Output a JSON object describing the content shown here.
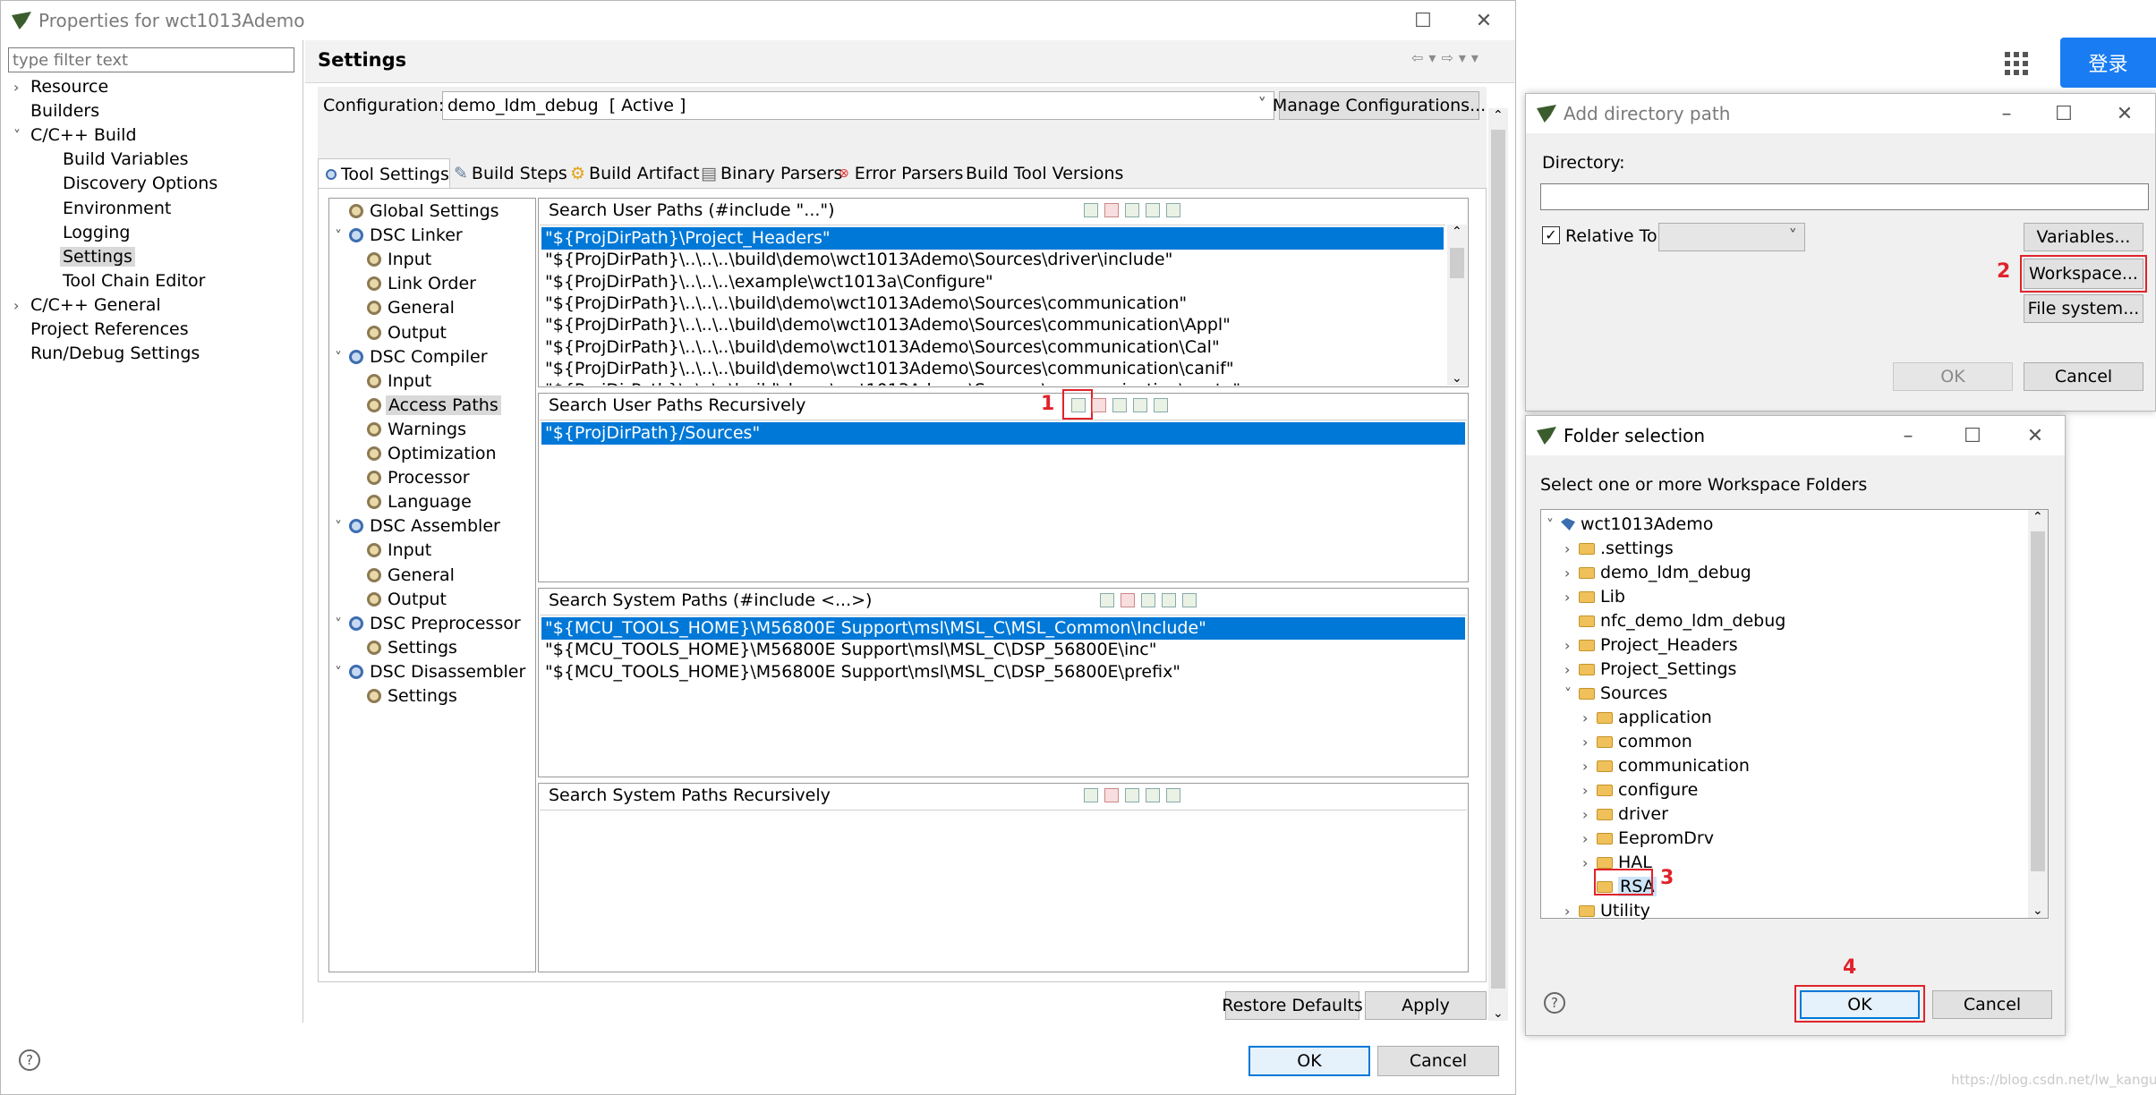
{
  "main_window": {
    "title": "Properties for wct1013Ademo",
    "filter_placeholder": "type filter text",
    "nav": [
      {
        "label": "Resource",
        "indent": 0,
        "twisty": "›"
      },
      {
        "label": "Builders",
        "indent": 0,
        "twisty": ""
      },
      {
        "label": "C/C++ Build",
        "indent": 0,
        "twisty": "˅"
      },
      {
        "label": "Build Variables",
        "indent": 1,
        "twisty": ""
      },
      {
        "label": "Discovery Options",
        "indent": 1,
        "twisty": ""
      },
      {
        "label": "Environment",
        "indent": 1,
        "twisty": ""
      },
      {
        "label": "Logging",
        "indent": 1,
        "twisty": ""
      },
      {
        "label": "Settings",
        "indent": 1,
        "twisty": "",
        "selected": true
      },
      {
        "label": "Tool Chain Editor",
        "indent": 1,
        "twisty": ""
      },
      {
        "label": "C/C++ General",
        "indent": 0,
        "twisty": "›"
      },
      {
        "label": "Project References",
        "indent": 0,
        "twisty": ""
      },
      {
        "label": "Run/Debug Settings",
        "indent": 0,
        "twisty": ""
      }
    ],
    "page_title": "Settings",
    "configuration_label": "Configuration:",
    "configuration_value": "demo_ldm_debug  [ Active ]",
    "manage_button": "Manage Configurations...",
    "tabs": [
      "Tool Settings",
      "Build Steps",
      "Build Artifact",
      "Binary Parsers",
      "Error Parsers",
      "Build Tool Versions"
    ],
    "tool_tree": [
      {
        "label": "Global Settings",
        "level": 0,
        "twisty": "",
        "icon": "gear"
      },
      {
        "label": "DSC Linker",
        "level": 0,
        "twisty": "˅",
        "icon": "bluegear"
      },
      {
        "label": "Input",
        "level": 1,
        "twisty": "",
        "icon": "gear"
      },
      {
        "label": "Link Order",
        "level": 1,
        "twisty": "",
        "icon": "gear"
      },
      {
        "label": "General",
        "level": 1,
        "twisty": "",
        "icon": "gear"
      },
      {
        "label": "Output",
        "level": 1,
        "twisty": "",
        "icon": "gear"
      },
      {
        "label": "DSC Compiler",
        "level": 0,
        "twisty": "˅",
        "icon": "bluegear"
      },
      {
        "label": "Input",
        "level": 1,
        "twisty": "",
        "icon": "gear"
      },
      {
        "label": "Access Paths",
        "level": 1,
        "twisty": "",
        "icon": "gear",
        "selected": true
      },
      {
        "label": "Warnings",
        "level": 1,
        "twisty": "",
        "icon": "gear"
      },
      {
        "label": "Optimization",
        "level": 1,
        "twisty": "",
        "icon": "gear"
      },
      {
        "label": "Processor",
        "level": 1,
        "twisty": "",
        "icon": "gear"
      },
      {
        "label": "Language",
        "level": 1,
        "twisty": "",
        "icon": "gear"
      },
      {
        "label": "DSC Assembler",
        "level": 0,
        "twisty": "˅",
        "icon": "bluegear"
      },
      {
        "label": "Input",
        "level": 1,
        "twisty": "",
        "icon": "gear"
      },
      {
        "label": "General",
        "level": 1,
        "twisty": "",
        "icon": "gear"
      },
      {
        "label": "Output",
        "level": 1,
        "twisty": "",
        "icon": "gear"
      },
      {
        "label": "DSC Preprocessor",
        "level": 0,
        "twisty": "˅",
        "icon": "bluegear"
      },
      {
        "label": "Settings",
        "level": 1,
        "twisty": "",
        "icon": "gear"
      },
      {
        "label": "DSC Disassembler",
        "level": 0,
        "twisty": "˅",
        "icon": "bluegear"
      },
      {
        "label": "Settings",
        "level": 1,
        "twisty": "",
        "icon": "gear"
      }
    ],
    "sections": {
      "user_paths": {
        "title": "Search User Paths (#include \"...\")",
        "items": [
          "\"${ProjDirPath}\\Project_Headers\"",
          "\"${ProjDirPath}\\..\\..\\..\\build\\demo\\wct1013Ademo\\Sources\\driver\\include\"",
          "\"${ProjDirPath}\\..\\..\\..\\example\\wct1013a\\Configure\"",
          "\"${ProjDirPath}\\..\\..\\..\\build\\demo\\wct1013Ademo\\Sources\\communication\"",
          "\"${ProjDirPath}\\..\\..\\..\\build\\demo\\wct1013Ademo\\Sources\\communication\\Appl\"",
          "\"${ProjDirPath}\\..\\..\\..\\build\\demo\\wct1013Ademo\\Sources\\communication\\Cal\"",
          "\"${ProjDirPath}\\..\\..\\..\\build\\demo\\wct1013Ademo\\Sources\\communication\\canif\"",
          "\"${ProjDirPath}\\..\\..\\..\\build\\demo\\wct1013Ademo\\Sources\\communication\\cantp\""
        ]
      },
      "user_recursive": {
        "title": "Search User Paths Recursively",
        "items": [
          "\"${ProjDirPath}/Sources\""
        ]
      },
      "system_paths": {
        "title": "Search System Paths (#include <...>)",
        "items": [
          "\"${MCU_TOOLS_HOME}\\M56800E Support\\msl\\MSL_C\\MSL_Common\\Include\"",
          "\"${MCU_TOOLS_HOME}\\M56800E Support\\msl\\MSL_C\\DSP_56800E\\inc\"",
          "\"${MCU_TOOLS_HOME}\\M56800E Support\\msl\\MSL_C\\DSP_56800E\\prefix\""
        ]
      },
      "system_recursive": {
        "title": "Search System Paths Recursively",
        "items": []
      }
    },
    "restore_defaults": "Restore Defaults",
    "apply": "Apply",
    "ok": "OK",
    "cancel": "Cancel",
    "help": "?"
  },
  "add_dir_dialog": {
    "title": "Add directory path",
    "directory_label": "Directory:",
    "directory_value": "",
    "relative_label": "Relative To:",
    "relative_checked": true,
    "variables_button": "Variables...",
    "workspace_button": "Workspace...",
    "filesystem_button": "File system...",
    "ok": "OK",
    "cancel": "Cancel"
  },
  "folder_dialog": {
    "title": "Folder selection",
    "instruction": "Select one or more Workspace Folders",
    "tree": [
      {
        "label": "wct1013Ademo",
        "level": 0,
        "twisty": "˅",
        "icon": "project"
      },
      {
        "label": ".settings",
        "level": 1,
        "twisty": "›",
        "icon": "folder"
      },
      {
        "label": "demo_ldm_debug",
        "level": 1,
        "twisty": "›",
        "icon": "folder"
      },
      {
        "label": "Lib",
        "level": 1,
        "twisty": "›",
        "icon": "folder"
      },
      {
        "label": "nfc_demo_ldm_debug",
        "level": 1,
        "twisty": "",
        "icon": "folder"
      },
      {
        "label": "Project_Headers",
        "level": 1,
        "twisty": "›",
        "icon": "folder"
      },
      {
        "label": "Project_Settings",
        "level": 1,
        "twisty": "›",
        "icon": "folder"
      },
      {
        "label": "Sources",
        "level": 1,
        "twisty": "˅",
        "icon": "folder"
      },
      {
        "label": "application",
        "level": 2,
        "twisty": "›",
        "icon": "folder"
      },
      {
        "label": "common",
        "level": 2,
        "twisty": "›",
        "icon": "folder"
      },
      {
        "label": "communication",
        "level": 2,
        "twisty": "›",
        "icon": "folder"
      },
      {
        "label": "configure",
        "level": 2,
        "twisty": "›",
        "icon": "folder"
      },
      {
        "label": "driver",
        "level": 2,
        "twisty": "›",
        "icon": "folder"
      },
      {
        "label": "EepromDrv",
        "level": 2,
        "twisty": "›",
        "icon": "folder"
      },
      {
        "label": "HAL",
        "level": 2,
        "twisty": "›",
        "icon": "folder"
      },
      {
        "label": "RSA",
        "level": 2,
        "twisty": "",
        "icon": "folder",
        "selected": true
      },
      {
        "label": "Utility",
        "level": 1,
        "twisty": "›",
        "icon": "folder"
      }
    ],
    "ok": "OK",
    "cancel": "Cancel",
    "help": "?"
  },
  "annotations": [
    "1",
    "2",
    "3",
    "4"
  ],
  "background_page": {
    "login_button": "登录",
    "watermark": "https://blog.csdn.net/lw_kangur"
  },
  "colors": {
    "selection": "#0078d7",
    "annotation_red": "#e0232b",
    "login_blue": "#1a7cf2"
  }
}
